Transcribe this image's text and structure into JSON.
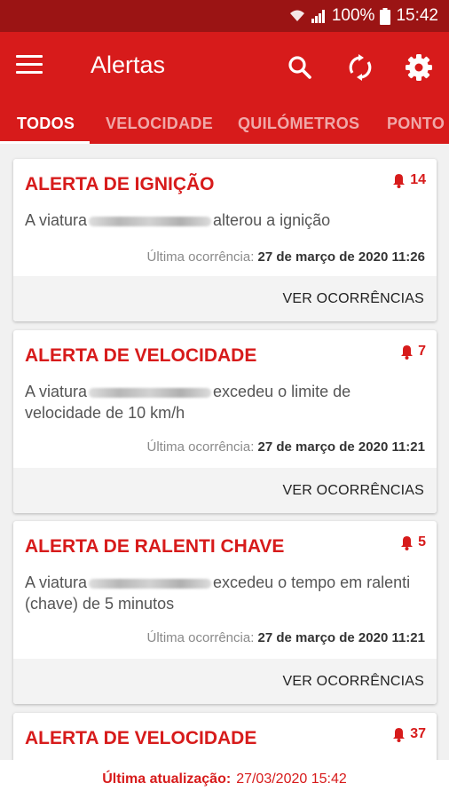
{
  "status_bar": {
    "battery": "100%",
    "time": "15:42"
  },
  "app_bar": {
    "title": "Alertas",
    "icons": [
      "menu-icon",
      "search-icon",
      "sync-icon",
      "gear-icon"
    ]
  },
  "tabs": [
    "TODOS",
    "VELOCIDADE",
    "QUILÓMETROS",
    "PONTO"
  ],
  "alerts": [
    {
      "title": "ALERTA DE IGNIÇÃO",
      "count": "14",
      "msg_prefix": "A viatura",
      "msg_suffix": "alterou a ignição",
      "last_label": "Última ocorrência:",
      "last_date": "27 de março de 2020 11:26",
      "action": "VER OCORRÊNCIAS"
    },
    {
      "title": "ALERTA DE VELOCIDADE",
      "count": "7",
      "msg_prefix": "A viatura",
      "msg_suffix": "excedeu o limite de velocidade de 10 km/h",
      "last_label": "Última ocorrência:",
      "last_date": "27 de março de 2020 11:21",
      "action": "VER OCORRÊNCIAS"
    },
    {
      "title": "ALERTA DE RALENTI CHAVE",
      "count": "5",
      "msg_prefix": "A viatura",
      "msg_suffix": "excedeu o tempo em ralenti (chave) de 5 minutos",
      "last_label": "Última ocorrência:",
      "last_date": "27 de março de 2020 11:21",
      "action": "VER OCORRÊNCIAS"
    },
    {
      "title": "ALERTA DE VELOCIDADE",
      "count": "37"
    }
  ],
  "footer": {
    "label": "Última atualização:",
    "value": "27/03/2020 15:42"
  },
  "colors": {
    "primary": "#d71b1b",
    "status_bar": "#9b1414"
  }
}
